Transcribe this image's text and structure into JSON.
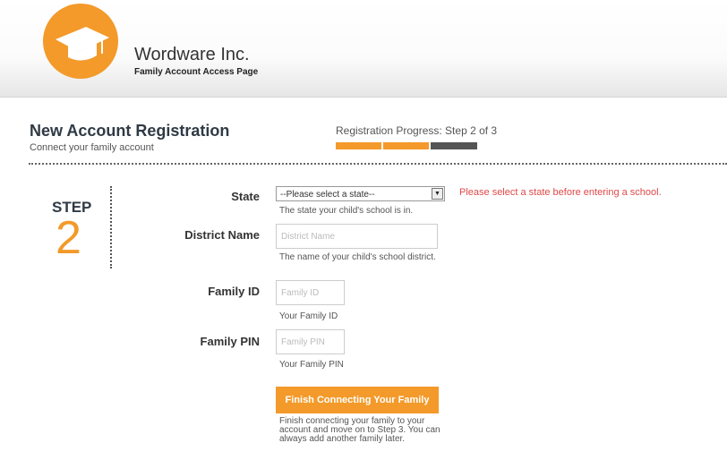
{
  "header": {
    "company": "Wordware Inc.",
    "subtitle": "Family Account Access Page",
    "logo_icon": "graduation-cap-icon",
    "brand_color": "#f39a2a"
  },
  "registration": {
    "title": "New Account Registration",
    "subtitle": "Connect your family account",
    "progress_label": "Registration Progress: Step 2 of 3",
    "progress": {
      "current_step": 2,
      "total_steps": 3
    }
  },
  "step": {
    "word": "STEP",
    "number": "2"
  },
  "form": {
    "state": {
      "label": "State",
      "selected": "--Please select a state--",
      "help": "The state your child's school is in.",
      "error": "Please select a state before entering a school."
    },
    "district": {
      "label": "District Name",
      "placeholder": "District Name",
      "value": "",
      "help": "The name of your child's school district."
    },
    "family_id": {
      "label": "Family ID",
      "placeholder": "Family ID",
      "value": "",
      "help": "Your Family ID"
    },
    "family_pin": {
      "label": "Family PIN",
      "placeholder": "Family PIN",
      "value": "",
      "help": "Your Family PIN"
    },
    "finish": {
      "label": "Finish Connecting Your Family",
      "help": "Finish connecting your family to your account and move on to Step 3. You can always add another family later."
    }
  }
}
